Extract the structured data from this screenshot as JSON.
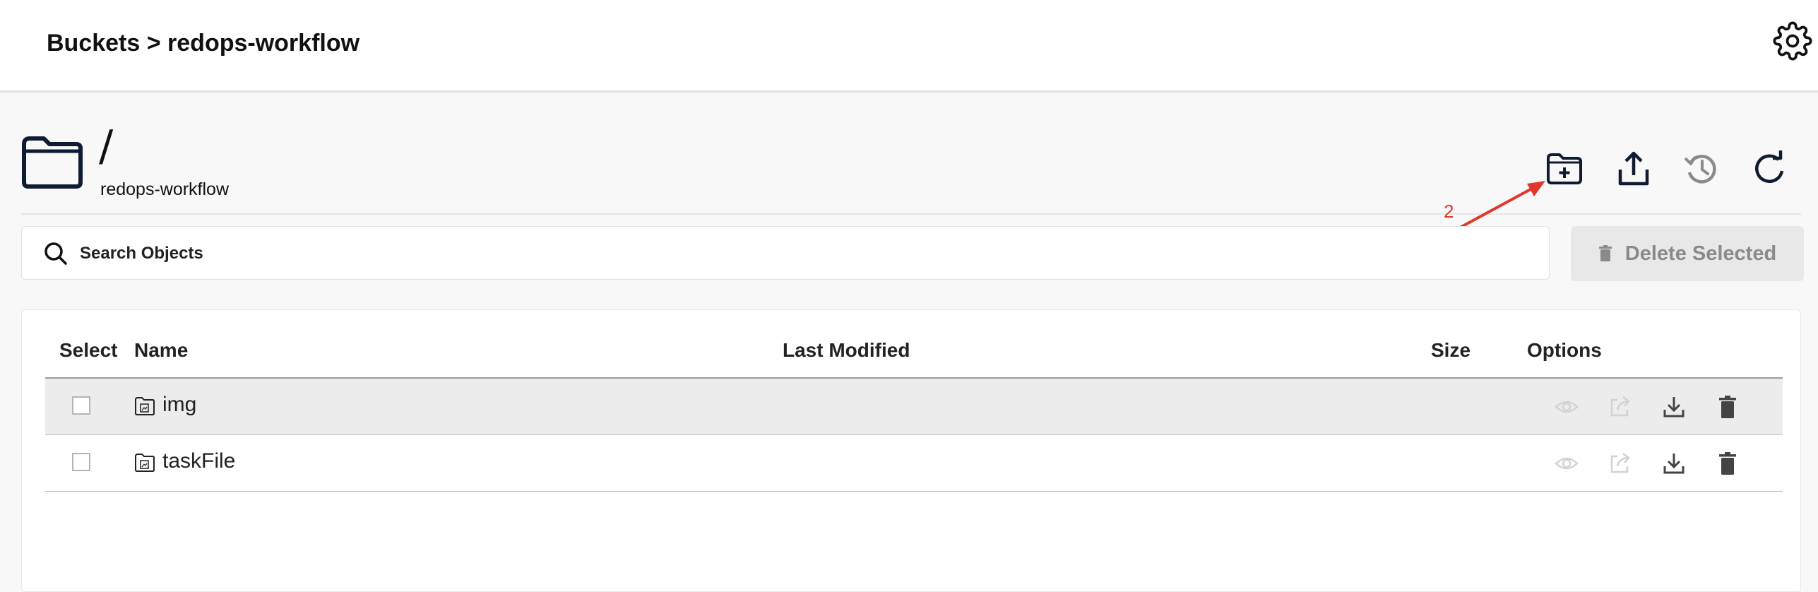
{
  "header": {
    "breadcrumb": "Buckets > redops-workflow",
    "settings_icon": "gear-icon"
  },
  "path": {
    "current": "/",
    "bucket": "redops-workflow"
  },
  "toolbar": {
    "icons": [
      "folder-plus-icon",
      "upload-icon",
      "history-icon",
      "refresh-icon"
    ]
  },
  "search": {
    "placeholder": "Search Objects"
  },
  "delete_button": {
    "label": "Delete Selected",
    "icon": "trash-icon"
  },
  "table": {
    "columns": [
      "Select",
      "Name",
      "Last Modified",
      "Size",
      "Options"
    ],
    "rows": [
      {
        "name": "img",
        "last_modified": "",
        "size": ""
      },
      {
        "name": "taskFile",
        "last_modified": "",
        "size": ""
      }
    ],
    "row_options": [
      "eye-icon",
      "share-icon",
      "download-icon",
      "trash-icon"
    ]
  },
  "annotation": {
    "number": "2",
    "color": "#e0362b"
  }
}
